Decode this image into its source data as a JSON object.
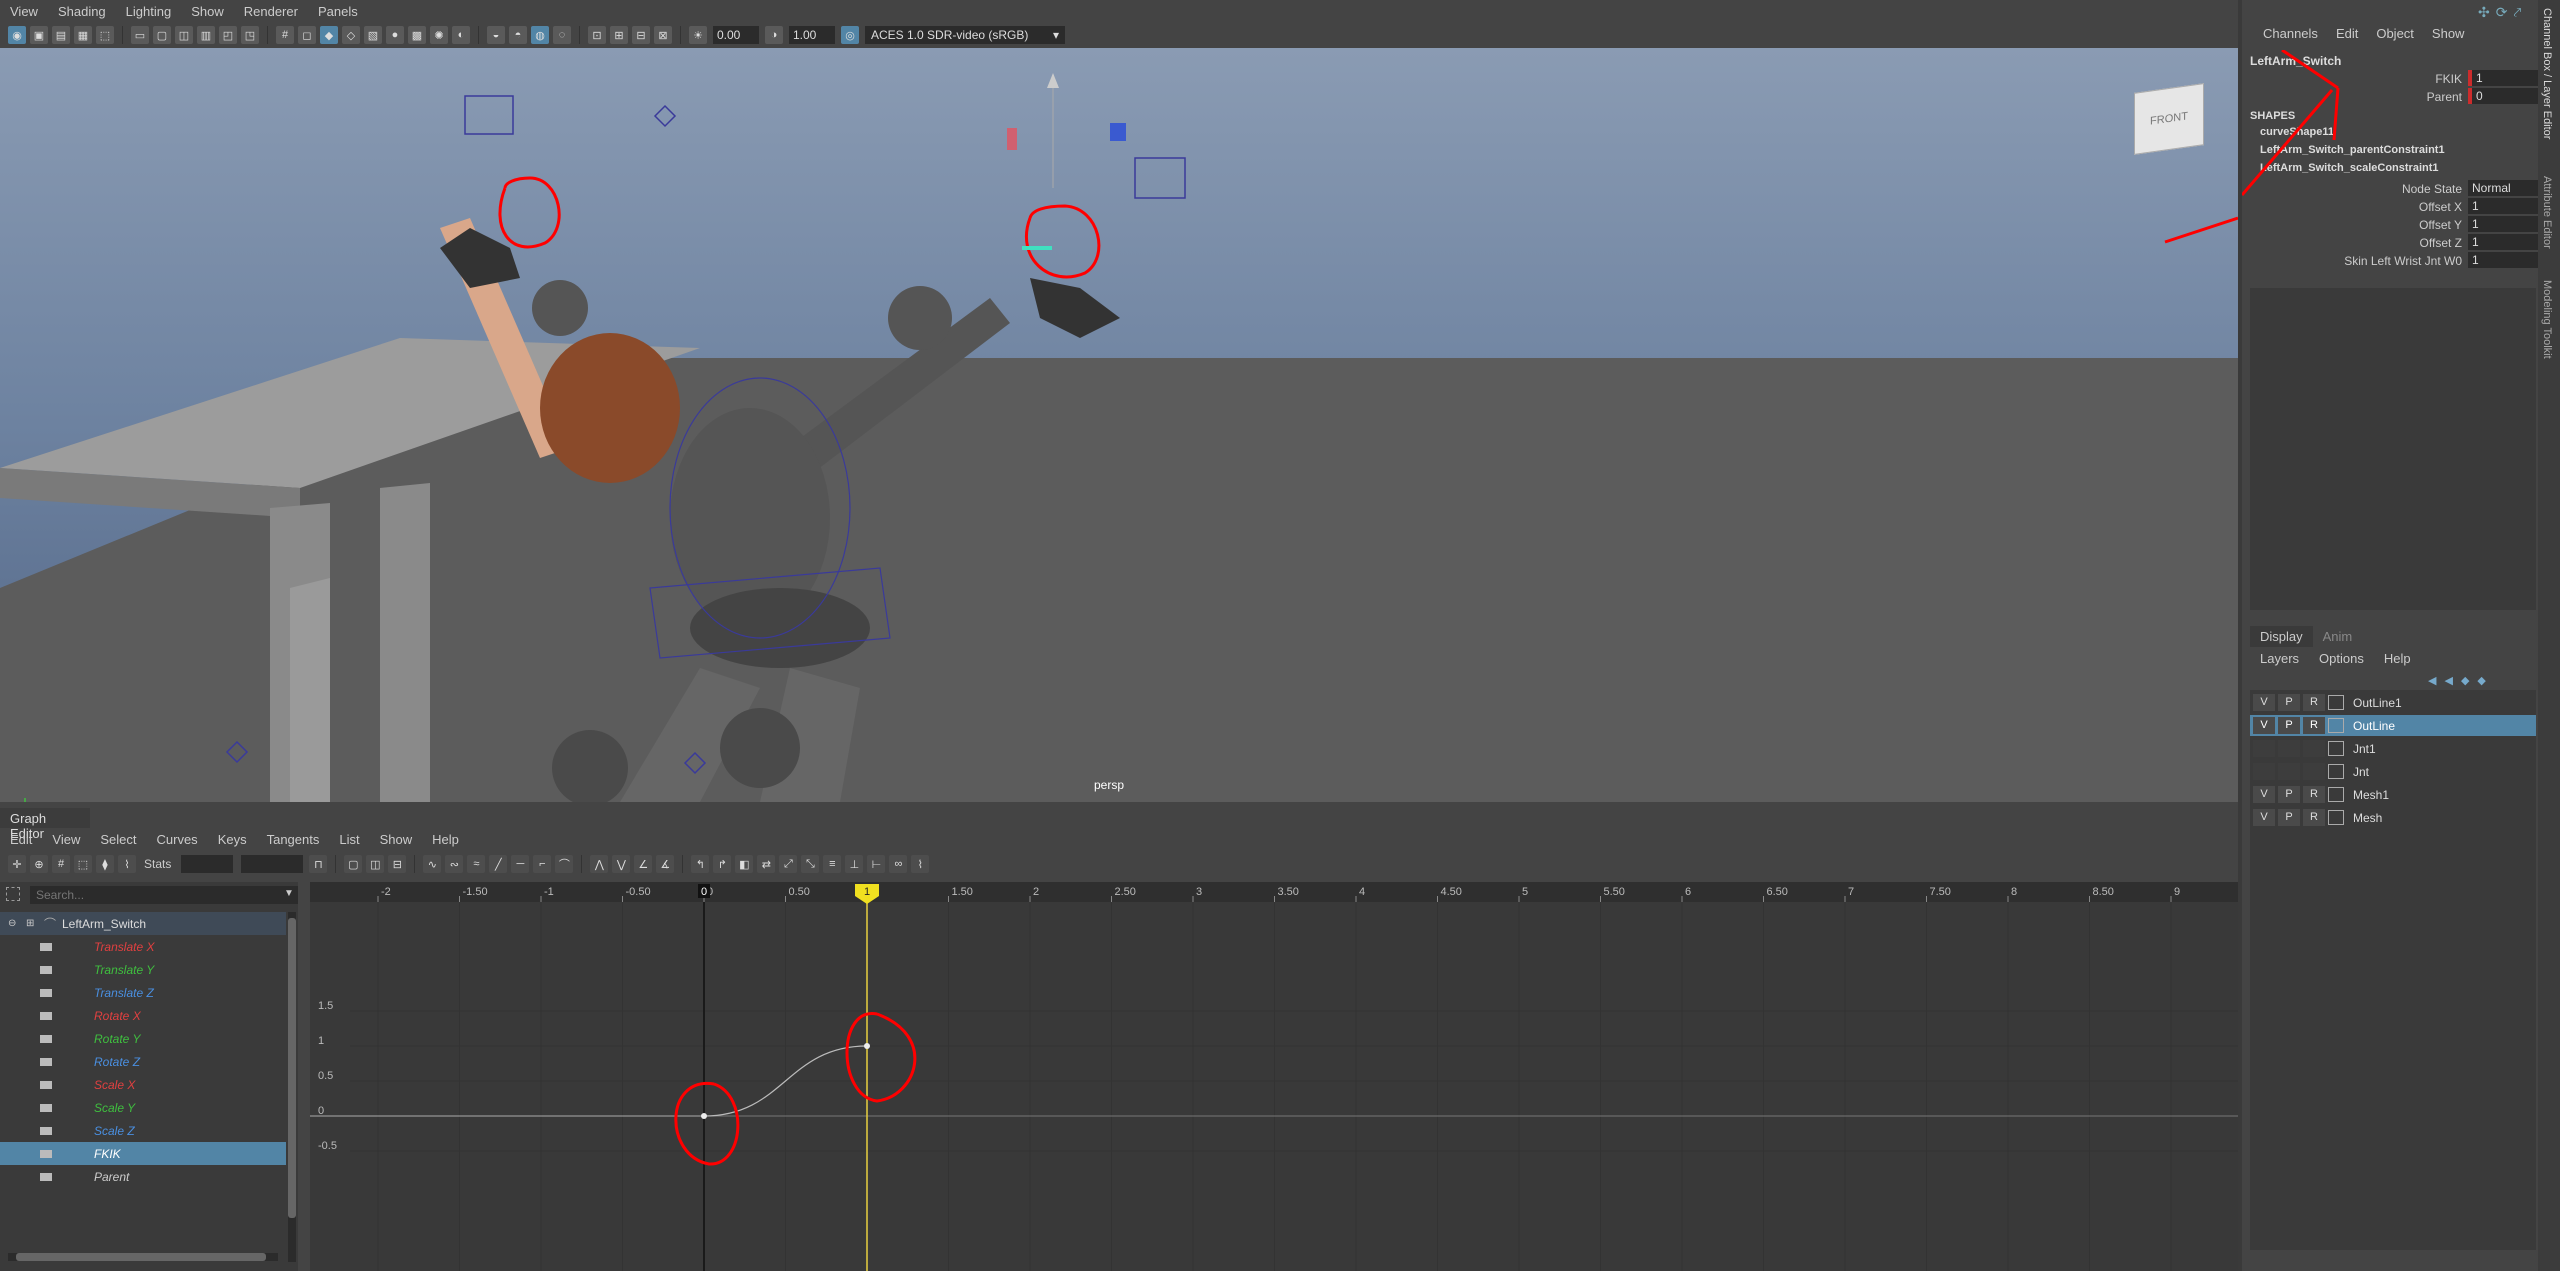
{
  "main_menu": [
    "View",
    "Shading",
    "Lighting",
    "Show",
    "Renderer",
    "Panels"
  ],
  "toolbar": {
    "exposure": "0.00",
    "gamma": "1.00",
    "color_space": "ACES 1.0 SDR-video (sRGB)"
  },
  "viewport": {
    "camera_label": "persp",
    "view_cube_label": "FRONT"
  },
  "graph_editor": {
    "title": "Graph Editor",
    "menu": [
      "Edit",
      "View",
      "Select",
      "Curves",
      "Keys",
      "Tangents",
      "List",
      "Show",
      "Help"
    ],
    "stats_label": "Stats",
    "search_placeholder": "Search...",
    "object_name": "LeftArm_Switch",
    "channels": [
      {
        "name": "Translate X",
        "color": "#e04040"
      },
      {
        "name": "Translate Y",
        "color": "#3fbf3f"
      },
      {
        "name": "Translate Z",
        "color": "#4a8fe0"
      },
      {
        "name": "Rotate X",
        "color": "#e04040"
      },
      {
        "name": "Rotate Y",
        "color": "#3fbf3f"
      },
      {
        "name": "Rotate Z",
        "color": "#4a8fe0"
      },
      {
        "name": "Scale X",
        "color": "#e04040"
      },
      {
        "name": "Scale Y",
        "color": "#3fbf3f"
      },
      {
        "name": "Scale Z",
        "color": "#4a8fe0"
      },
      {
        "name": "FKIK",
        "color": "#ffffff"
      },
      {
        "name": "Parent",
        "color": "#cccccc"
      }
    ],
    "selected_channel": "FKIK",
    "x_ticks": [
      "-2",
      "-1.50",
      "-1",
      "-0.50",
      "0",
      "0.50",
      "1",
      "1.50",
      "2",
      "2.50",
      "3",
      "3.50",
      "4",
      "4.50",
      "5",
      "5.50",
      "6",
      "6.50",
      "7",
      "7.50",
      "8",
      "8.50",
      "9"
    ],
    "y_ticks": [
      "1.5",
      "1",
      "0.5",
      "0",
      "-0.5"
    ],
    "current_frame": "1",
    "start_frame": "0",
    "curve_keys": [
      {
        "time": 0,
        "value": 0
      },
      {
        "time": 1,
        "value": 1
      }
    ]
  },
  "channel_box": {
    "menu": [
      "Channels",
      "Edit",
      "Object",
      "Show"
    ],
    "object_name": "LeftArm_Switch",
    "attributes": [
      {
        "label": "FKIK",
        "value": "1"
      },
      {
        "label": "Parent",
        "value": "0"
      }
    ],
    "shapes_header": "SHAPES",
    "shapes": [
      "curveShape11",
      "LeftArm_Switch_parentConstraint1",
      "LeftArm_Switch_scaleConstraint1"
    ],
    "inputs": [
      {
        "label": "Node State",
        "value": "Normal"
      },
      {
        "label": "Offset X",
        "value": "1"
      },
      {
        "label": "Offset Y",
        "value": "1"
      },
      {
        "label": "Offset Z",
        "value": "1"
      },
      {
        "label": "Skin Left Wrist Jnt W0",
        "value": "1"
      }
    ]
  },
  "layer_editor": {
    "tabs": [
      "Display",
      "Anim"
    ],
    "menu": [
      "Layers",
      "Options",
      "Help"
    ],
    "layers": [
      {
        "v": "V",
        "p": "P",
        "r": "R",
        "name": "OutLine1"
      },
      {
        "v": "V",
        "p": "P",
        "r": "R",
        "name": "OutLine"
      },
      {
        "v": "",
        "p": "",
        "r": "",
        "name": "Jnt1"
      },
      {
        "v": "",
        "p": "",
        "r": "",
        "name": "Jnt"
      },
      {
        "v": "V",
        "p": "P",
        "r": "R",
        "name": "Mesh1"
      },
      {
        "v": "V",
        "p": "P",
        "r": "R",
        "name": "Mesh"
      }
    ],
    "selected_layer": "OutLine"
  },
  "side_tabs": [
    "Channel Box / Layer Editor",
    "Attribute Editor",
    "Modeling Toolkit"
  ],
  "annotation_color": "#ff0000"
}
